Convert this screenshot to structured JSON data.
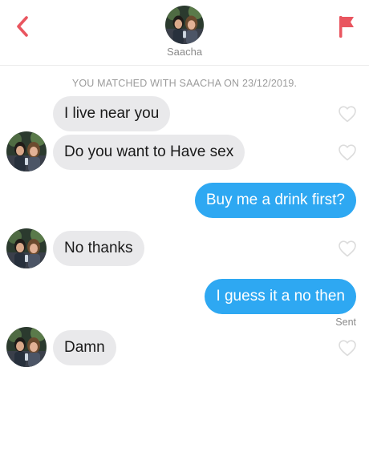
{
  "header": {
    "name": "Saacha",
    "accent_color": "#e9555f"
  },
  "match_notice": "YOU MATCHED WITH SAACHA ON 23/12/2019.",
  "messages": [
    {
      "text": "I live near you",
      "from": "them"
    },
    {
      "text": "Do you want to Have sex",
      "from": "them"
    },
    {
      "text": "Buy me a drink first?",
      "from": "me"
    },
    {
      "text": "No thanks",
      "from": "them"
    },
    {
      "text": "I guess it a no then",
      "from": "me"
    },
    {
      "text": "Damn",
      "from": "them"
    }
  ],
  "status": {
    "sent": "Sent"
  },
  "colors": {
    "incoming_bubble": "#e9e9eb",
    "outgoing_bubble": "#2ea8f2"
  },
  "icons": [
    "back-chevron-icon",
    "report-flag-icon",
    "heart-outline-icon"
  ]
}
